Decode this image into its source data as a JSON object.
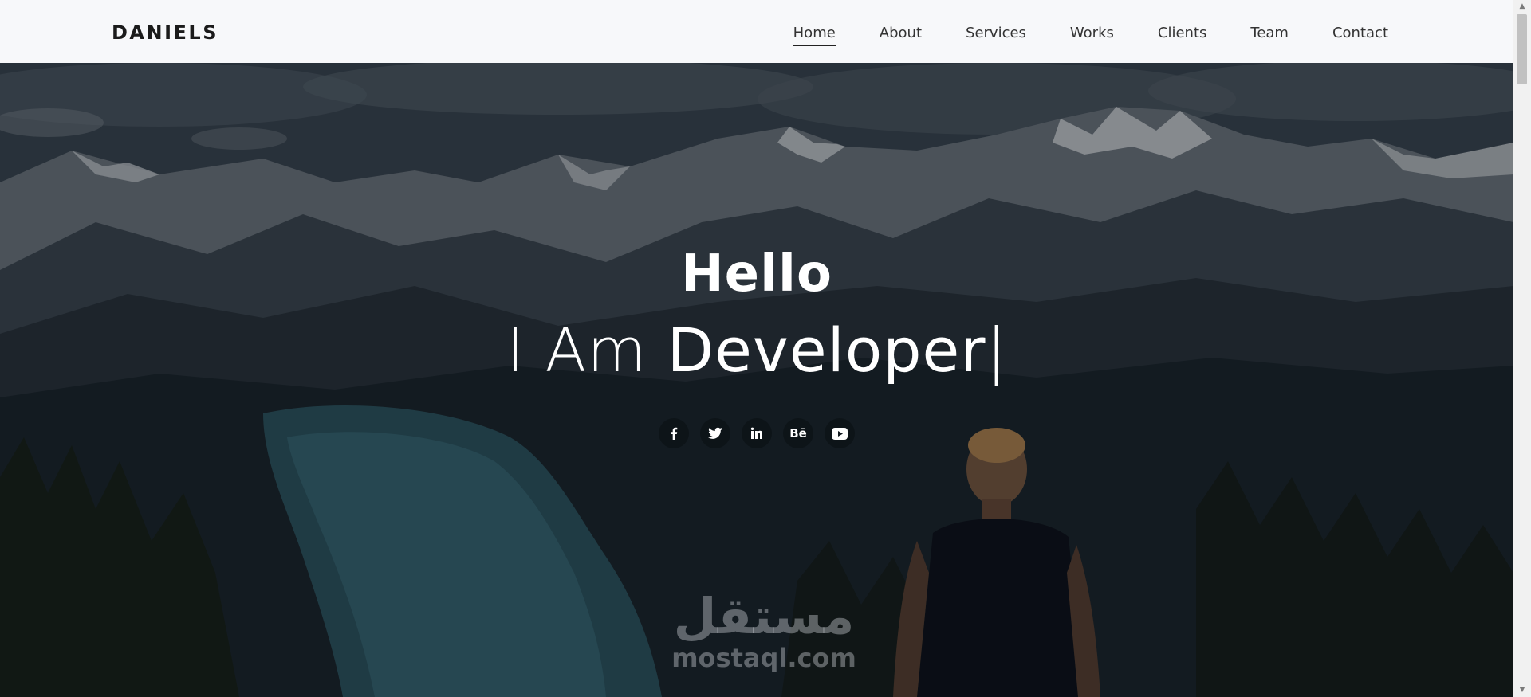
{
  "brand": {
    "logo": "DANIELS"
  },
  "nav": {
    "items": [
      {
        "label": "Home",
        "active": true
      },
      {
        "label": "About",
        "active": false
      },
      {
        "label": "Services",
        "active": false
      },
      {
        "label": "Works",
        "active": false
      },
      {
        "label": "Clients",
        "active": false
      },
      {
        "label": "Team",
        "active": false
      },
      {
        "label": "Contact",
        "active": false
      }
    ]
  },
  "hero": {
    "greeting": "Hello",
    "typed_prefix": "I Am",
    "typed_word": "Developer",
    "cursor": "|",
    "socials": [
      {
        "icon": "facebook-icon"
      },
      {
        "icon": "twitter-icon"
      },
      {
        "icon": "linkedin-icon"
      },
      {
        "icon": "behance-icon",
        "glyph": "Bē"
      },
      {
        "icon": "youtube-icon"
      }
    ]
  },
  "watermark": {
    "arabic": "مستقل",
    "latin": "mostaql.com"
  },
  "colors": {
    "navbar_bg": "#f7f8fa",
    "text_dark": "#1b1b1b",
    "hero_text": "#ffffff"
  }
}
